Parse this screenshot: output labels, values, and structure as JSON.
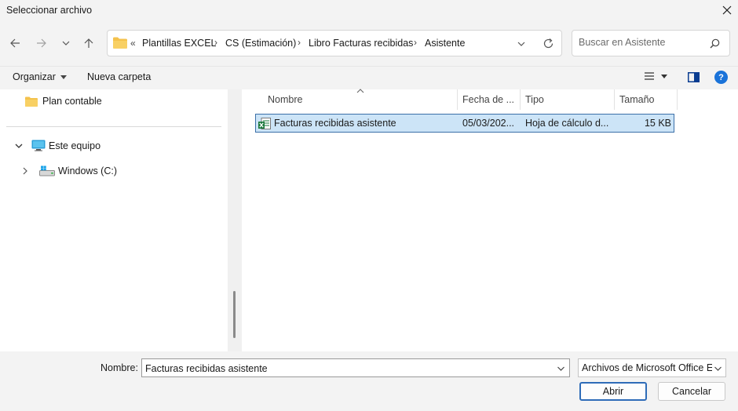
{
  "window": {
    "title": "Seleccionar archivo"
  },
  "address_bar": {
    "overflow": "«",
    "crumbs": [
      "Plantillas EXCEL",
      "CS (Estimación)",
      "Libro Facturas recibidas",
      "Asistente"
    ]
  },
  "search": {
    "placeholder": "Buscar en Asistente"
  },
  "toolbar": {
    "organize_label": "Organizar",
    "new_folder_label": "Nueva carpeta",
    "help_glyph": "?"
  },
  "nav_tree": {
    "items": [
      {
        "label": "Plan contable",
        "icon": "folder-icon"
      },
      {
        "label": "Este equipo",
        "icon": "monitor-icon"
      },
      {
        "label": "Windows (C:)",
        "icon": "drive-icon"
      }
    ]
  },
  "file_list": {
    "columns": [
      "Nombre",
      "Fecha de ...",
      "Tipo",
      "Tamaño"
    ],
    "rows": [
      {
        "name": "Facturas recibidas asistente",
        "date": "05/03/202...",
        "type": "Hoja de cálculo d...",
        "size": "15 KB",
        "selected": true
      }
    ]
  },
  "bottom": {
    "name_label": "Nombre:",
    "name_value": "Facturas recibidas asistente",
    "filter_value": "Archivos de Microsoft Office Ex",
    "open_label": "Abrir",
    "cancel_label": "Cancelar"
  },
  "colors": {
    "accent": "#2e6cb8",
    "selection": "#cce4f7",
    "folder": "#f4c24c",
    "excel_green": "#1d7a3e",
    "help_blue": "#1a73d9"
  }
}
